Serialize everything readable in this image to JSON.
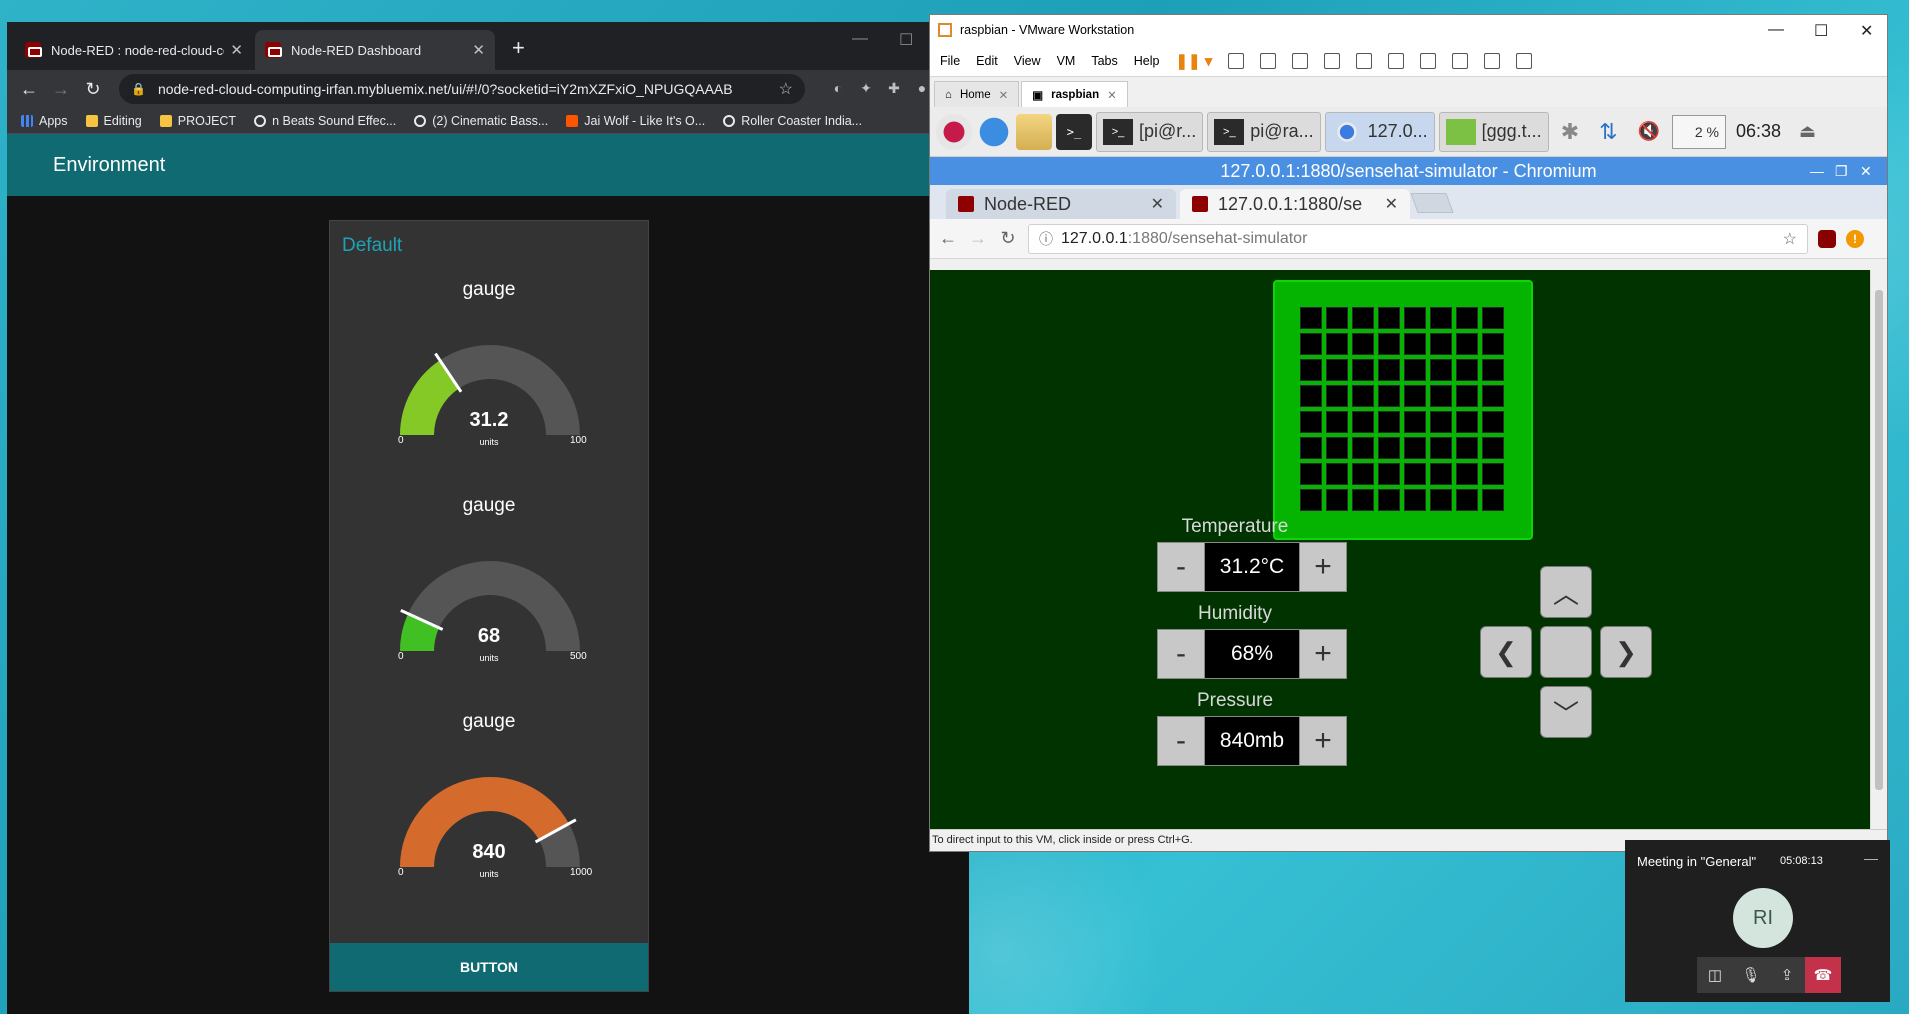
{
  "chrome": {
    "tabs": [
      {
        "title": "Node-RED : node-red-cloud-cor"
      },
      {
        "title": "Node-RED Dashboard"
      }
    ],
    "url": "node-red-cloud-computing-irfan.mybluemix.net/ui/#!/0?socketid=iY2mXZFxiO_NPUGQAAAB",
    "bookmarks": [
      "Apps",
      "Editing",
      "PROJECT",
      "n Beats Sound Effec...",
      "(2) Cinematic Bass...",
      "Jai Wolf - Like It's O...",
      "Roller Coaster India..."
    ]
  },
  "dashboard": {
    "header_title": "Environment",
    "group_title": "Default",
    "gauges": [
      {
        "title": "gauge",
        "value": "31.2",
        "units": "units",
        "min": "0",
        "max": "100",
        "fraction": 0.312,
        "color": "#85c926"
      },
      {
        "title": "gauge",
        "value": "68",
        "units": "units",
        "min": "0",
        "max": "500",
        "fraction": 0.136,
        "color": "#40c022"
      },
      {
        "title": "gauge",
        "value": "840",
        "units": "units",
        "min": "0",
        "max": "1000",
        "fraction": 0.84,
        "color": "#d46b2c"
      }
    ],
    "button_label": "BUTTON"
  },
  "vmware": {
    "title": "raspbian - VMware Workstation",
    "menu": [
      "File",
      "Edit",
      "View",
      "VM",
      "Tabs",
      "Help"
    ],
    "tabs": [
      {
        "label": "Home"
      },
      {
        "label": "raspbian"
      }
    ],
    "status": "To direct input to this VM, click inside or press Ctrl+G."
  },
  "raspbian_panel": {
    "tasks": [
      "[pi@r...",
      "pi@ra...",
      "127.0...",
      "[ggg.t..."
    ],
    "cpu": "2 %",
    "clock": "06:38"
  },
  "chromium": {
    "window_title": "127.0.0.1:1880/sensehat-simulator - Chromium",
    "tabs": [
      "Node-RED",
      "127.0.0.1:1880/se"
    ],
    "url_host": "127.0.0.1",
    "url_rest": ":1880/sensehat-simulator"
  },
  "simulator": {
    "temperature": {
      "label": "Temperature",
      "value": "31.2°C"
    },
    "humidity": {
      "label": "Humidity",
      "value": "68%"
    },
    "pressure": {
      "label": "Pressure",
      "value": "840mb"
    }
  },
  "teams": {
    "title": "Meeting in \"General\"",
    "timer": "05:08:13",
    "initials": "RI"
  }
}
